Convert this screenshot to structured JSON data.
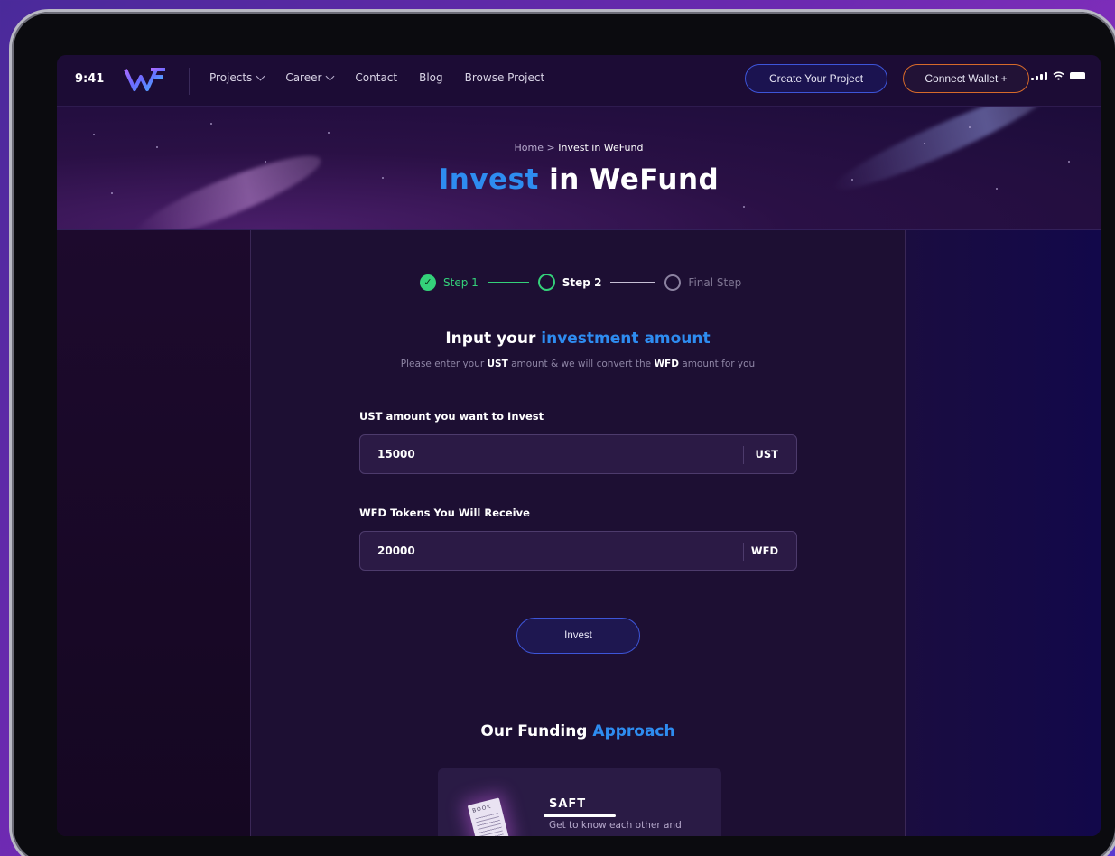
{
  "status_bar": {
    "time": "9:41"
  },
  "nav": {
    "items": [
      {
        "label": "Projects",
        "dropdown": true
      },
      {
        "label": "Career",
        "dropdown": true
      },
      {
        "label": "Contact",
        "dropdown": false
      },
      {
        "label": "Blog",
        "dropdown": false
      },
      {
        "label": "Browse Project",
        "dropdown": false
      }
    ],
    "create_label": "Create Your Project",
    "wallet_label": "Connect Wallet +"
  },
  "hero": {
    "breadcrumb_home": "Home",
    "breadcrumb_sep": ">",
    "breadcrumb_current": "Invest in WeFund",
    "title_accent": "Invest",
    "title_rest": "in WeFund"
  },
  "stepper": {
    "step1": "Step 1",
    "step1_check": "✓",
    "step2": "Step 2",
    "step3": "Final Step"
  },
  "form": {
    "title_plain": "Input your",
    "title_accent": "investment amount",
    "subtitle_1": "Please enter your",
    "subtitle_ust": "UST",
    "subtitle_2": "amount & we will convert the",
    "subtitle_wfd": "WFD",
    "subtitle_3": "amount for you",
    "ust_label": "UST amount you want to Invest",
    "ust_value": "15000",
    "ust_unit": "UST",
    "wfd_label": "WFD Tokens You Will Receive",
    "wfd_value": "20000",
    "wfd_unit": "WFD",
    "invest_label": "Invest"
  },
  "approach": {
    "title_plain": "Our Funding",
    "title_accent": "Approach",
    "card_title": "SAFT",
    "card_text": "Get to know each other and",
    "book_label": "BOOK"
  },
  "colors": {
    "accent_blue": "#2e8cf0",
    "step_green": "#34d17a",
    "wallet_border": "#d66a2a"
  }
}
